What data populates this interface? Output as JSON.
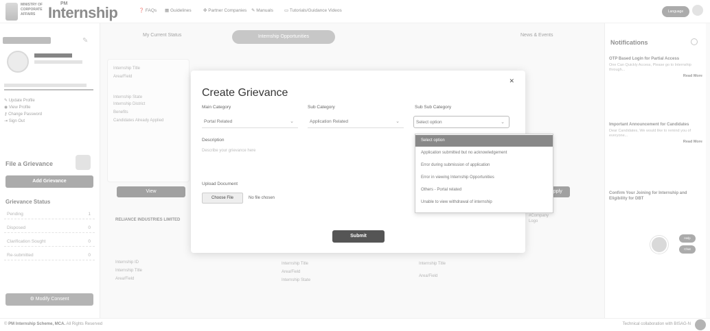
{
  "header": {
    "ministry_lines": [
      "MINISTRY OF",
      "CORPORATE",
      "AFFAIRS"
    ],
    "brand_prefix": "PM",
    "brand_name": "Internship",
    "nav": [
      "FAQs",
      "Guidelines",
      "Partner Companies",
      "Manuals",
      "Tutorials/Guidance Videos"
    ],
    "language_button": "Language"
  },
  "sidebar": {
    "links": [
      "Update Profile",
      "View Profile",
      "Change Password",
      "Sign Out"
    ],
    "file_grievance": "File a Grievance",
    "add_grievance_button": "Add Grievance",
    "grievance_status_title": "Grievance Status",
    "status_rows": [
      {
        "label": "Pending",
        "count": "1"
      },
      {
        "label": "Disposed",
        "count": "0"
      },
      {
        "label": "Clarification Sought",
        "count": "0"
      },
      {
        "label": "Re-submitted",
        "count": "0"
      }
    ],
    "modify_consent_button": "Modify Consent"
  },
  "tabs": [
    "My Current Status",
    "Internship Opportunities",
    "",
    "News & Events"
  ],
  "background": {
    "card_labels": [
      "Internship Title",
      "Area/Field",
      "Internship State",
      "Internship District",
      "Benefits",
      "Candidates Already Applied"
    ],
    "view_button": "View",
    "apply_button": "Apply",
    "company_name": "RELIANCE INDUSTRIES LIMITED",
    "company_logo_label": "#Company Logo",
    "bottom_labels": [
      "Internship ID",
      "Internship Title",
      "Area/Field",
      "Internship Title",
      "Area/Field",
      "Internship State",
      "Internship Title",
      "Area/Field"
    ]
  },
  "notifications": {
    "title": "Notifications",
    "items": [
      {
        "head": "OTP Based Login for Partial Access",
        "body": "One Can Quickly Access, Please go to Internship through...",
        "more": "Read More"
      },
      {
        "head": "Important Announcement for Candidates",
        "body": "Dear Candidates, We would like to remind you of everyone...",
        "more": "Read More"
      },
      {
        "head": "Confirm Your Joining for Internship and Eligibility for DBT",
        "body": "",
        "more": ""
      }
    ],
    "chat_pills": [
      "Help",
      "Chat"
    ]
  },
  "modal": {
    "title": "Create Grievance",
    "main_category_label": "Main Category",
    "main_category_value": "Portal Related",
    "sub_category_label": "Sub Category",
    "sub_category_value": "Application Related",
    "sub_sub_category_label": "Sub Sub Category",
    "sub_sub_category_value": "Select option",
    "description_label": "Description",
    "description_placeholder": "Describe your grievance here",
    "upload_label": "Upload Document",
    "choose_file_button": "Choose File",
    "no_file_text": "No file chosen",
    "submit_button": "Submit",
    "dropdown_options": [
      "Select option",
      "Application submitted but no acknowledgement",
      "Error during submission of application",
      "Error in viewing Internship Opportunities",
      "Others - Portal related",
      "Unable to view withdrawal of internship"
    ]
  },
  "footer": {
    "brand": "PM Internship Scheme, MCA.",
    "rights": "All Rights Reserved",
    "collab": "Technical collaboration with BISAG-N"
  }
}
